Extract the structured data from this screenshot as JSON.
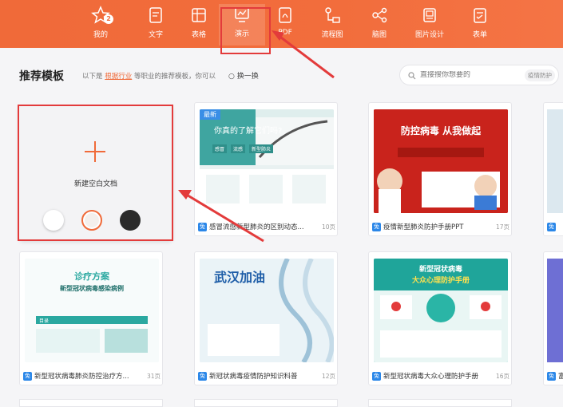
{
  "nav": {
    "items": [
      {
        "label": "我的",
        "icon": "star-icon",
        "badge": "2"
      },
      {
        "label": "文字",
        "icon": "document-icon"
      },
      {
        "label": "表格",
        "icon": "table-icon"
      },
      {
        "label": "演示",
        "icon": "presentation-icon",
        "active": true
      },
      {
        "label": "PDF",
        "icon": "pdf-icon"
      },
      {
        "label": "流程图",
        "icon": "flowchart-icon"
      },
      {
        "label": "脑图",
        "icon": "mindmap-icon"
      },
      {
        "label": "图片设计",
        "icon": "image-design-icon"
      },
      {
        "label": "表单",
        "icon": "form-icon"
      }
    ]
  },
  "header": {
    "title": "推荐模板",
    "hint_prefix": "以下是",
    "hint_link": "根据行业",
    "hint_suffix": "等职业的推荐模板，你可以",
    "refresh_label": "换一换"
  },
  "search": {
    "placeholder": "直接搜你想要的",
    "tag": "疫情防护"
  },
  "blank": {
    "label": "新建空白文档",
    "swatches": [
      "#ffffff",
      "#f4efec",
      "#2b2b2b"
    ]
  },
  "cards": [
    {
      "title": "感冒流感新型肺炎的区别动态...",
      "pages": "10页",
      "new_badge": "最新",
      "free": "免",
      "thumb": {
        "headline": "你真的了解它们吗?",
        "tags": [
          "感冒",
          "流感",
          "新型肺炎"
        ]
      }
    },
    {
      "title": "疫情新型肺炎防护手册PPT",
      "pages": "17页",
      "free": "免",
      "thumb": {
        "headline": "防控病毒 从我做起"
      }
    },
    {
      "title": "新型冠状病毒肺炎防控治疗方...",
      "pages": "31页",
      "free": "免",
      "thumb": {
        "headline": "诊疗方案",
        "sub": "新型冠状病毒感染病例",
        "sec": "目录"
      }
    },
    {
      "title": "新冠状病毒疫情防护知识科普",
      "pages": "12页",
      "free": "免",
      "thumb": {
        "headline": "武汉加油"
      }
    },
    {
      "title": "新型冠状病毒大众心理防护手册",
      "pages": "16页",
      "free": "免",
      "thumb": {
        "headline": "新型冠状病毒",
        "sub": "大众心理防护手册"
      }
    }
  ],
  "partial_caption": "富",
  "colors": {
    "accent": "#f06a39",
    "highlight": "#e33b3b",
    "free_badge": "#2b87e8"
  }
}
